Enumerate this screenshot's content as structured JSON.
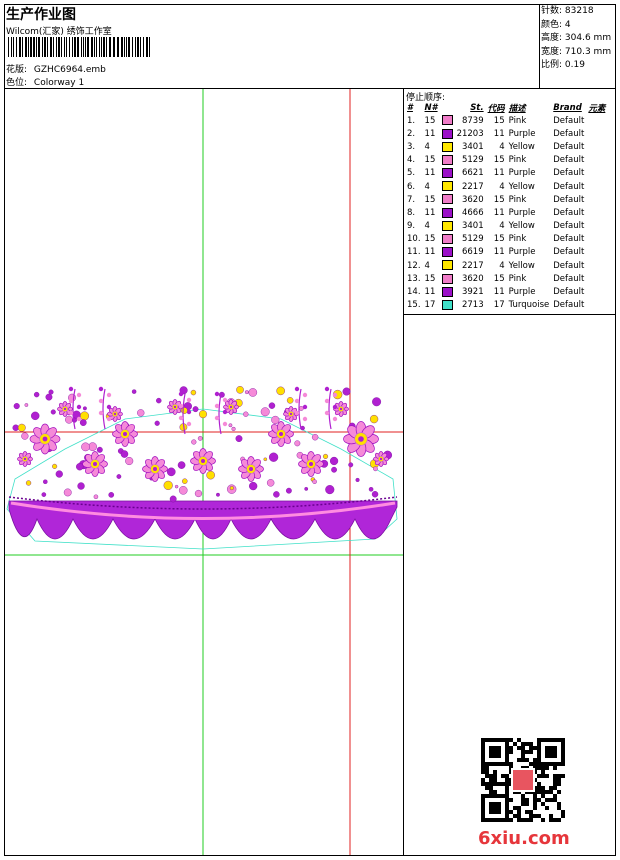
{
  "header": {
    "title": "生产作业图",
    "subtitle": "Wilcom(汇家) 绣饰工作室",
    "file_label": "花版:",
    "file_name": "GZHC6964.emb",
    "colorway_label": "色位:",
    "colorway": "Colorway 1"
  },
  "stats": [
    {
      "label": "针数:",
      "value": "83218"
    },
    {
      "label": "颜色:",
      "value": "4"
    },
    {
      "label": "高度:",
      "value": "304.6 mm"
    },
    {
      "label": "宽度:",
      "value": "710.3 mm"
    },
    {
      "label": "比例:",
      "value": "0.19"
    }
  ],
  "stop_sequence": {
    "title": "停止顺序:",
    "columns": [
      "#",
      "N#",
      "St.",
      "代码",
      "描述",
      "Brand",
      "元素"
    ],
    "rows": [
      {
        "idx": "1.",
        "n": "15",
        "st": "8739",
        "code": "15",
        "desc": "Pink",
        "brand": "Default",
        "color": "#f07cc8"
      },
      {
        "idx": "2.",
        "n": "11",
        "st": "21203",
        "code": "11",
        "desc": "Purple",
        "brand": "Default",
        "color": "#9b10c8"
      },
      {
        "idx": "3.",
        "n": "4",
        "st": "3401",
        "code": "4",
        "desc": "Yellow",
        "brand": "Default",
        "color": "#ffe800"
      },
      {
        "idx": "4.",
        "n": "15",
        "st": "5129",
        "code": "15",
        "desc": "Pink",
        "brand": "Default",
        "color": "#f07cc8"
      },
      {
        "idx": "5.",
        "n": "11",
        "st": "6621",
        "code": "11",
        "desc": "Purple",
        "brand": "Default",
        "color": "#9b10c8"
      },
      {
        "idx": "6.",
        "n": "4",
        "st": "2217",
        "code": "4",
        "desc": "Yellow",
        "brand": "Default",
        "color": "#ffe800"
      },
      {
        "idx": "7.",
        "n": "15",
        "st": "3620",
        "code": "15",
        "desc": "Pink",
        "brand": "Default",
        "color": "#f07cc8"
      },
      {
        "idx": "8.",
        "n": "11",
        "st": "4666",
        "code": "11",
        "desc": "Purple",
        "brand": "Default",
        "color": "#9b10c8"
      },
      {
        "idx": "9.",
        "n": "4",
        "st": "3401",
        "code": "4",
        "desc": "Yellow",
        "brand": "Default",
        "color": "#ffe800"
      },
      {
        "idx": "10.",
        "n": "15",
        "st": "5129",
        "code": "15",
        "desc": "Pink",
        "brand": "Default",
        "color": "#f07cc8"
      },
      {
        "idx": "11.",
        "n": "11",
        "st": "6619",
        "code": "11",
        "desc": "Purple",
        "brand": "Default",
        "color": "#9b10c8"
      },
      {
        "idx": "12.",
        "n": "4",
        "st": "2217",
        "code": "4",
        "desc": "Yellow",
        "brand": "Default",
        "color": "#ffe800"
      },
      {
        "idx": "13.",
        "n": "15",
        "st": "3620",
        "code": "15",
        "desc": "Pink",
        "brand": "Default",
        "color": "#f07cc8"
      },
      {
        "idx": "14.",
        "n": "11",
        "st": "3921",
        "code": "11",
        "desc": "Purple",
        "brand": "Default",
        "color": "#9b10c8"
      },
      {
        "idx": "15.",
        "n": "17",
        "st": "2713",
        "code": "17",
        "desc": "Turquoise",
        "brand": "Default",
        "color": "#40e0c8"
      }
    ]
  },
  "watermark": "6xiu.com"
}
